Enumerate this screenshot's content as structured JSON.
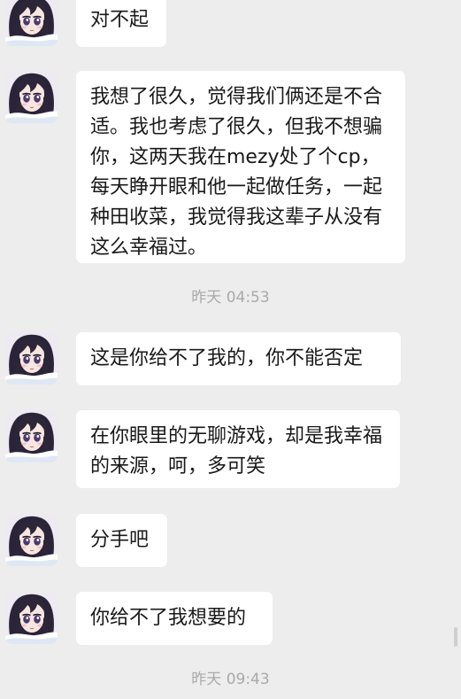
{
  "messages": [
    {
      "text": "对不起"
    },
    {
      "text": "我想了很久，觉得我们俩还是不合适。我也考虑了很久，但我不想骗你，这两天我在mezy处了个cp，每天睁开眼和他一起做任务，一起种田收菜，我觉得我这辈子从没有这么幸福过。"
    },
    {
      "text": "这是你给不了我的，你不能否定"
    },
    {
      "text": "在你眼里的无聊游戏，却是我幸福的来源，呵，多可笑"
    },
    {
      "text": "分手吧"
    },
    {
      "text": "你给不了我想要的"
    }
  ],
  "timestamps": [
    {
      "text": "昨天 04:53"
    },
    {
      "text": "昨天 09:43"
    }
  ],
  "colors": {
    "background": "#ededed",
    "bubble": "#ffffff",
    "text": "#191919",
    "timestamp": "#a9a9a9"
  },
  "icons": {
    "avatar": "anime-girl-avatar-icon"
  }
}
